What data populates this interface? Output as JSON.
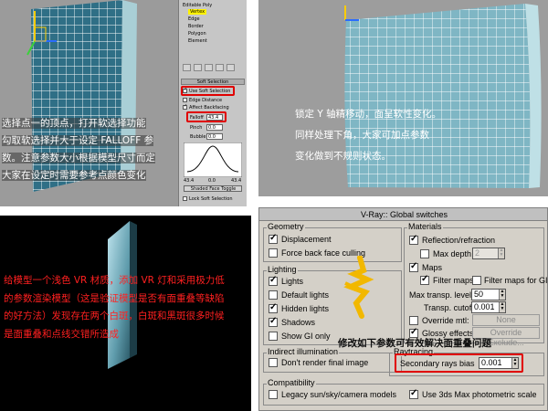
{
  "panel1": {
    "modifier_stack": [
      "Editable Poly",
      "Vertex",
      "Edge",
      "Border",
      "Polygon",
      "Element"
    ],
    "selected_item": "Vertex",
    "soft_selection": {
      "rollout_title": "Soft Selection",
      "use_soft_selection": "Use Soft Selection",
      "edge_distance": "Edge Distance",
      "affect_backfacing": "Affect Backfacing",
      "falloff_label": "Falloff",
      "falloff_value": "43.4",
      "pinch_label": "Pinch",
      "pinch_value": "0.0",
      "bubble_label": "Bubble",
      "bubble_value": "0.0",
      "curve_left": "43.4",
      "curve_mid": "0.0",
      "curve_right": "43.4",
      "shaded_face_toggle": "Shaded Face Toggle",
      "lock_soft_selection": "Lock Soft Selection"
    },
    "caption_lines": [
      "选择点一的顶点，打开软选择功能",
      "勾取软选择并大于设定 FALLOFF 参",
      "数。注意参数大小根据模型尺寸而定",
      "大家在设定时需要参考点颜色变化"
    ]
  },
  "panel2": {
    "caption_lines": [
      "锁定 Y 轴精移动，面呈软性变化。",
      "同样处理下角，大家可加点参数",
      "变化做到不规则状态。"
    ]
  },
  "panel3": {
    "caption_lines": [
      "给模型一个浅色 VR 材质，添加 VR 灯和采用极力低",
      "的参数渲染模型（这是验证模型是否有面重叠等缺陷",
      "的好方法）发现存在两个白斑，白斑和黑斑很多时候",
      "是面重叠和点线交错所造成"
    ]
  },
  "vray": {
    "title": "V-Ray:: Global switches",
    "geometry": {
      "label": "Geometry",
      "displacement": "Displacement",
      "force_back_face": "Force back face culling"
    },
    "lighting": {
      "label": "Lighting",
      "lights": "Lights",
      "default_lights": "Default lights",
      "hidden_lights": "Hidden lights",
      "shadows": "Shadows",
      "show_gi_only": "Show GI only"
    },
    "indirect": {
      "label": "Indirect illumination",
      "dont_render": "Don't render final image"
    },
    "compatibility": {
      "label": "Compatibility",
      "legacy": "Legacy sun/sky/camera models",
      "use_3ds_max": "Use 3ds Max photometric scale"
    },
    "materials": {
      "label": "Materials",
      "reflection": "Reflection/refraction",
      "max_depth": "Max depth",
      "max_depth_value": "2",
      "maps": "Maps",
      "filter_maps": "Filter maps",
      "filter_maps_gi": "Filter maps for GI",
      "max_transp_levels": "Max transp. levels",
      "max_transp_value": "50",
      "transp_cutoff": "Transp. cutoff",
      "transp_cutoff_value": "0.001",
      "override_mtl": "Override mtl:",
      "override_none": "None",
      "glossy_effects": "Glossy effects",
      "override_exclude": "Override Exclude..."
    },
    "raytracing": {
      "label": "Raytracing",
      "secondary_bias": "Secondary rays bias",
      "secondary_bias_value": "0.001"
    },
    "overlay_caption": "修改如下参数可有效解决面重叠问题"
  },
  "colors": {
    "highlight_red": "#e00000",
    "mesh_blue": "#a9cfd6",
    "selected_yellow": "#fff200"
  }
}
